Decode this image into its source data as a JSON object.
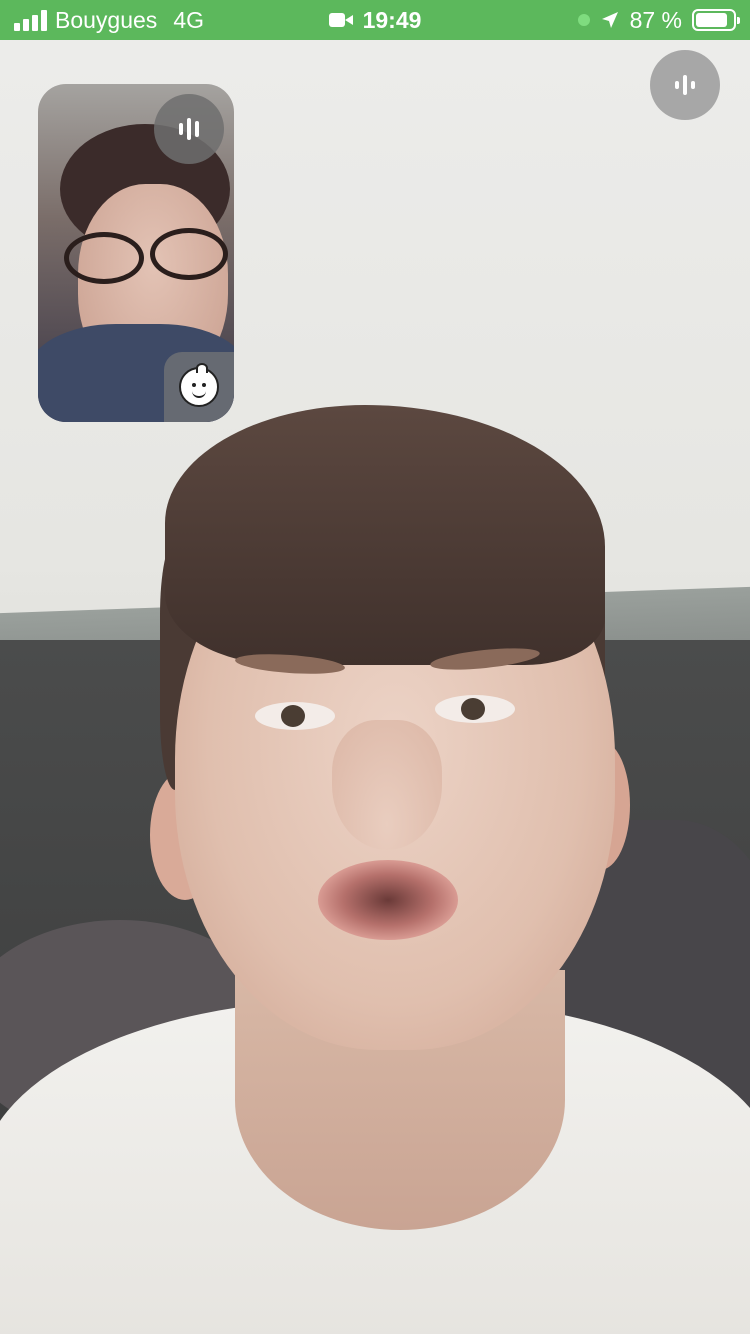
{
  "status_bar": {
    "carrier": "Bouygues",
    "network": "4G",
    "time": "19:49",
    "battery_percent": "87 %",
    "battery_level": 0.87,
    "icons": [
      "signal-icon",
      "video-camera-icon",
      "green-dot-icon",
      "location-arrow-icon",
      "battery-icon"
    ],
    "bar_color": "#5cb85c"
  },
  "call": {
    "self_preview": {
      "mute_icon": "audio-bars-icon",
      "effects_icon": "memoji-baby-icon"
    },
    "audio_button_icon": "audio-bars-icon"
  }
}
